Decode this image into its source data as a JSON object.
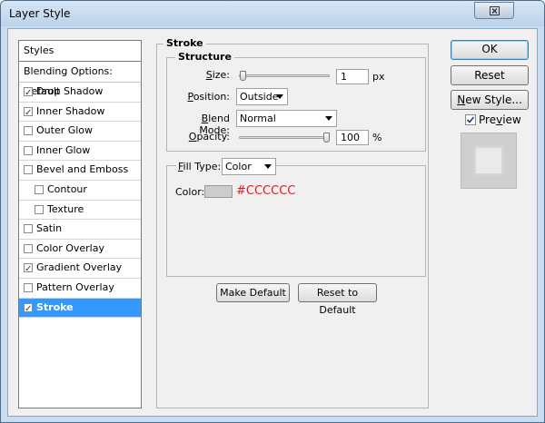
{
  "window": {
    "title": "Layer Style"
  },
  "styles_list": {
    "header": "Styles",
    "blending_options": "Blending Options: Default",
    "items": [
      {
        "label": "Drop Shadow",
        "checked": true,
        "indent": 0
      },
      {
        "label": "Inner Shadow",
        "checked": true,
        "indent": 0
      },
      {
        "label": "Outer Glow",
        "checked": false,
        "indent": 0
      },
      {
        "label": "Inner Glow",
        "checked": false,
        "indent": 0
      },
      {
        "label": "Bevel and Emboss",
        "checked": false,
        "indent": 0
      },
      {
        "label": "Contour",
        "checked": false,
        "indent": 1
      },
      {
        "label": "Texture",
        "checked": false,
        "indent": 1
      },
      {
        "label": "Satin",
        "checked": false,
        "indent": 0
      },
      {
        "label": "Color Overlay",
        "checked": false,
        "indent": 0
      },
      {
        "label": "Gradient Overlay",
        "checked": true,
        "indent": 0
      },
      {
        "label": "Pattern Overlay",
        "checked": false,
        "indent": 0
      },
      {
        "label": "Stroke",
        "checked": true,
        "indent": 0,
        "selected": true
      }
    ]
  },
  "stroke_panel": {
    "title": "Stroke",
    "structure": {
      "title": "Structure",
      "size": {
        "label": "Size:",
        "value": "1",
        "unit": "px",
        "slider_fraction": 0.01
      },
      "position": {
        "label": "Position:",
        "value": "Outside"
      },
      "blend_mode": {
        "label": "Blend Mode:",
        "value": "Normal"
      },
      "opacity": {
        "label": "Opacity:",
        "value": "100",
        "unit": "%",
        "slider_fraction": 1.0
      }
    },
    "fill": {
      "type_label": "Fill Type:",
      "type_value": "Color",
      "color_label": "Color:",
      "color_hex": "#CCCCCC",
      "color_value": "#cccccc",
      "annotation_color": "#e8191c"
    },
    "make_default": "Make Default",
    "reset_to_default": "Reset to Default"
  },
  "right_buttons": {
    "ok": "OK",
    "reset": "Reset",
    "new_style": "New Style...",
    "preview_label": "Preview",
    "preview_checked": true
  },
  "colors": {
    "selection": "#3399ff",
    "dialog_bg": "#f0f0f0",
    "frame": "#c9dcf0"
  },
  "icons": {
    "close": "close-icon",
    "check": "checkmark-icon",
    "dropdown": "chevron-down-icon"
  }
}
